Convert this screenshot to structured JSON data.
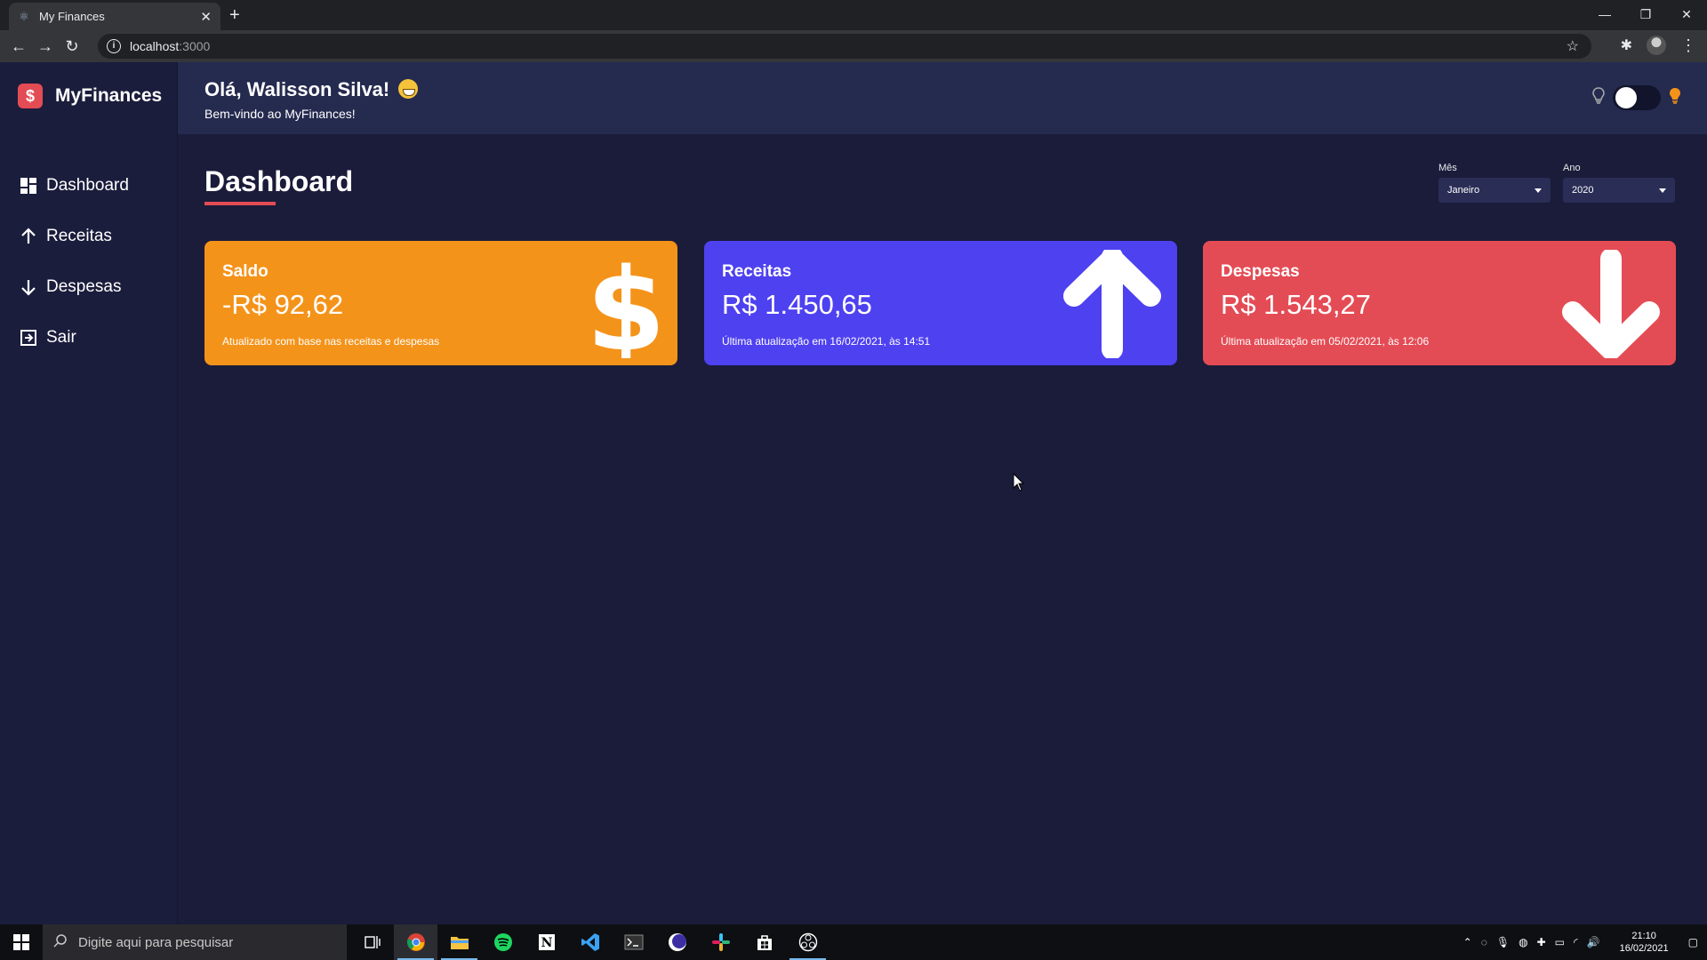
{
  "browser": {
    "tab_title": "My Finances",
    "url_host": "localhost",
    "url_port": ":3000"
  },
  "app": {
    "brand": "MyFinances",
    "brand_mark": "$",
    "greeting": "Olá, Walisson Silva!",
    "welcome": "Bem-vindo ao MyFinances!",
    "page_title": "Dashboard"
  },
  "sidebar": {
    "items": [
      {
        "label": "Dashboard",
        "icon": "dashboard-icon"
      },
      {
        "label": "Receitas",
        "icon": "arrow-up-icon"
      },
      {
        "label": "Despesas",
        "icon": "arrow-down-icon"
      },
      {
        "label": "Sair",
        "icon": "logout-icon"
      }
    ]
  },
  "filters": {
    "month_label": "Mês",
    "month_value": "Janeiro",
    "year_label": "Ano",
    "year_value": "2020"
  },
  "cards": [
    {
      "title": "Saldo",
      "value": "-R$ 92,62",
      "footer": "Atualizado com base nas receitas e despesas",
      "color": "#f4931a",
      "icon": "dollar-icon"
    },
    {
      "title": "Receitas",
      "value": "R$ 1.450,65",
      "footer": "Última atualização em 16/02/2021, às 14:51",
      "color": "#4e41f0",
      "icon": "arrow-up-icon"
    },
    {
      "title": "Despesas",
      "value": "R$ 1.543,27",
      "footer": "Última atualização em 05/02/2021, às 12:06",
      "color": "#e44c55",
      "icon": "arrow-down-icon"
    }
  ],
  "taskbar": {
    "search_placeholder": "Digite aqui para pesquisar",
    "time": "21:10",
    "date": "16/02/2021"
  },
  "colors": {
    "background": "#1a1c3a",
    "sidebar": "#1b1d3c",
    "header": "#252a4f",
    "accent": "#e44c55"
  }
}
